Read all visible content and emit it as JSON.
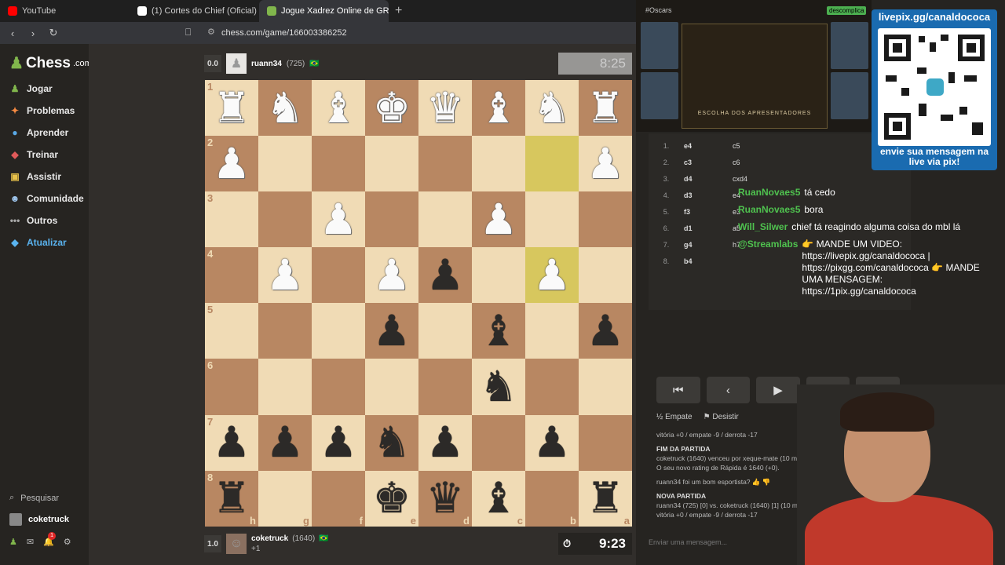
{
  "browser": {
    "tabs": [
      {
        "label": "YouTube",
        "color": "#ff0000"
      },
      {
        "label": "(1) Cortes do Chief (Oficial) no X: \"Ch",
        "color": "#ffffff"
      },
      {
        "label": "Jogue Xadrez Online de GRA",
        "color": "#81b64c"
      }
    ],
    "url": "chess.com/game/166003386252"
  },
  "sidebar": {
    "logo": "Chess",
    "logo_suffix": ".com",
    "items": [
      {
        "label": "Jogar",
        "icon": "play-icon"
      },
      {
        "label": "Problemas",
        "icon": "puzzle-icon"
      },
      {
        "label": "Aprender",
        "icon": "learn-icon"
      },
      {
        "label": "Treinar",
        "icon": "train-icon"
      },
      {
        "label": "Assistir",
        "icon": "watch-icon"
      },
      {
        "label": "Comunidade",
        "icon": "community-icon"
      },
      {
        "label": "Outros",
        "icon": "more-icon"
      },
      {
        "label": "Atualizar",
        "icon": "diamond-icon"
      }
    ],
    "search": "Pesquisar",
    "user": "coketruck",
    "notif_count": "1"
  },
  "top_player": {
    "score": "0.0",
    "name": "ruann34",
    "rating": "(725)",
    "flag": "🇧🇷",
    "clock": "8:25"
  },
  "bottom_player": {
    "score": "1.0",
    "name": "coketruck",
    "rating": "(1640)",
    "flag": "🇧🇷",
    "extra": "+1",
    "clock": "9:23"
  },
  "board": {
    "ranks": [
      "1",
      "2",
      "3",
      "4",
      "5",
      "6",
      "7",
      "8"
    ],
    "files": [
      "h",
      "g",
      "f",
      "e",
      "d",
      "c",
      "b",
      "a"
    ],
    "rows": [
      [
        "wr",
        "wn",
        "wb",
        "wk",
        "wq",
        "wb",
        "wn",
        "wr"
      ],
      [
        "wp",
        "",
        "",
        "",
        "",
        "",
        "",
        "wp"
      ],
      [
        "",
        "",
        "wp",
        "",
        "",
        "wp",
        "",
        ""
      ],
      [
        "",
        "wp",
        "",
        "wp",
        "bp",
        "",
        "wp",
        ""
      ],
      [
        "",
        "",
        "",
        "bp",
        "",
        "bb",
        "",
        "bp"
      ],
      [
        "",
        "",
        "",
        "",
        "",
        "bn",
        "",
        ""
      ],
      [
        "bp",
        "bp",
        "bp",
        "bn",
        "bp",
        "",
        "bp",
        ""
      ],
      [
        "br",
        "",
        "",
        "bk",
        "bq",
        "bb",
        "",
        "br"
      ]
    ],
    "highlight": [
      [
        1,
        6
      ],
      [
        3,
        6
      ]
    ]
  },
  "moves": [
    {
      "n": "1.",
      "w": "e4",
      "b": "c5"
    },
    {
      "n": "2.",
      "w": "c3",
      "b": "c6"
    },
    {
      "n": "3.",
      "w": "d4",
      "b": "cxd4"
    },
    {
      "n": "4.",
      "w": "d3",
      "b": "e4"
    },
    {
      "n": "5.",
      "w": "f3",
      "b": "e3"
    },
    {
      "n": "6.",
      "w": "d1",
      "b": "a5"
    },
    {
      "n": "7.",
      "w": "g4",
      "b": "h7"
    },
    {
      "n": "8.",
      "w": "b4",
      "b": ""
    }
  ],
  "chat": [
    {
      "name": "RuanNovaes5",
      "text": "tá cedo"
    },
    {
      "name": "RuanNovaes5",
      "text": "bora"
    },
    {
      "name": "Will_Silwer",
      "text": "chief tá reagindo alguma coisa do mbl lá"
    },
    {
      "name": "@Streamlabs",
      "text": "👉 MANDE UM VIDEO: https://livepix.gg/canaldococa | https://pixgg.com/canaldococa 👉 MANDE UMA MENSAGEM: https://1pix.gg/canaldococa"
    }
  ],
  "actions": {
    "draw": "Empate",
    "resign": "Desistir"
  },
  "log": {
    "line1": "vitória +0 / empate -9 / derrota -17",
    "end_title": "FIM DA PARTIDA",
    "end_text": "coketruck (1640) venceu por xeque-mate (10 min Co",
    "rating_text": "O seu novo rating de Rápida é 1640 (+0).",
    "sport": "ruann34 foi um bom esportista?",
    "new_title": "NOVA PARTIDA",
    "new_text": "ruann34 (725) [0] vs. coketruck (1640) [1] (10 m",
    "line2": "vitória +0 / empate -9 / derrota -17"
  },
  "chat_placeholder": "Enviar uma mensagem...",
  "stream": {
    "hashtag": "#Oscars",
    "brand": "descomplica",
    "stage_title": "ESCOLHA DOS APRESENTADORES"
  },
  "qr": {
    "top": "livepix.gg/canaldococa",
    "bottom": "envie sua mensagem na live via pix!"
  }
}
